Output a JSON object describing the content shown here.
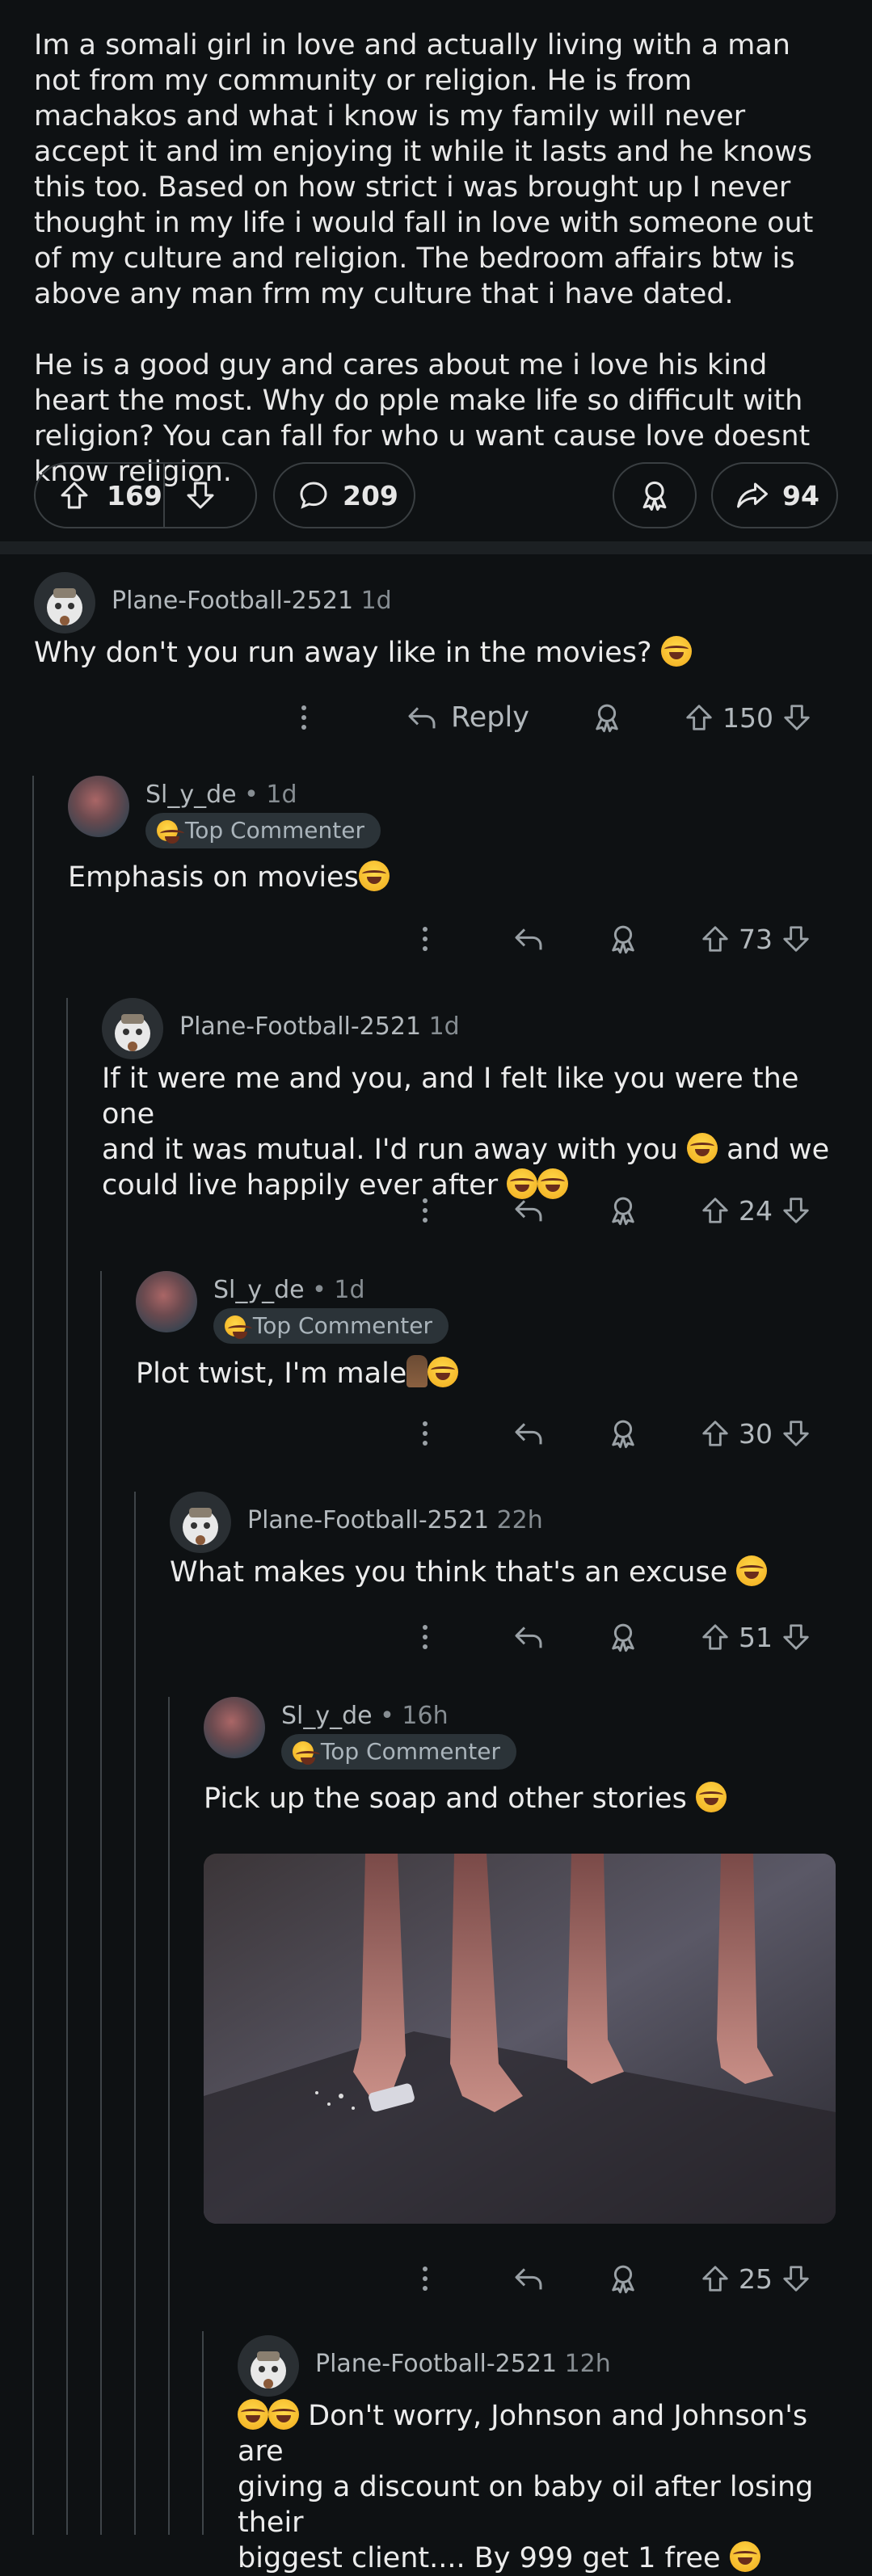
{
  "post": {
    "paragraphs": [
      "Im a somali girl in love and actually living with a man not from my community or religion. He is from machakos and what i know is my family will never accept it and im enjoying it while it lasts and he knows this too. Based on how strict i was brought up I never thought in my life i would fall in love with someone out of my culture and religion. The bedroom affairs btw is above any man frm my culture that i have dated.",
      "He is a good guy and cares about me i love his kind heart the most. Why do pple make life so difficult with religion? You can fall for who u want cause love doesnt know religion."
    ],
    "upvotes": "169",
    "comments": "209",
    "shares": "94"
  },
  "comments": [
    {
      "user": "Plane-Football-2521",
      "time": "1d",
      "text": "Why don't you run away like in the movies?",
      "votes": "150",
      "reply_label": "Reply"
    },
    {
      "user": "Sl_y_de",
      "time": " • 1d",
      "badge": "Top Commenter",
      "text": "Emphasis on movies",
      "votes": "73"
    },
    {
      "user": "Plane-Football-2521",
      "time": "1d",
      "text1": "If it were me and you, and I felt like you were the one",
      "text2": "and it was mutual. I'd run away with you",
      "text2b": " and we",
      "text3": "could live happily ever after",
      "votes": "24"
    },
    {
      "user": "Sl_y_de",
      "time": " • 1d",
      "badge": "Top Commenter",
      "text": "Plot twist, I'm male",
      "votes": "30"
    },
    {
      "user": "Plane-Football-2521",
      "time": "22h",
      "text": "What makes you think that's an excuse",
      "votes": "51"
    },
    {
      "user": "Sl_y_de",
      "time": " • 16h",
      "badge": "Top Commenter",
      "text": "Pick up the soap and other stories",
      "votes": "25"
    },
    {
      "user": "Plane-Football-2521",
      "time": "12h",
      "text1": " Don't worry, Johnson and Johnson's are",
      "text2": "giving a discount on baby oil after losing their",
      "text3": "biggest client.... By 999 get 1 free"
    }
  ],
  "colors": {
    "background": "#0e1113",
    "text": "#e8e8e8",
    "muted": "#868d92",
    "badge_bg": "#2b3338",
    "thread_line": "#3e4448"
  },
  "icons": [
    "upvote-icon",
    "downvote-icon",
    "comment-icon",
    "award-icon",
    "share-icon",
    "more-icon",
    "reply-icon"
  ]
}
